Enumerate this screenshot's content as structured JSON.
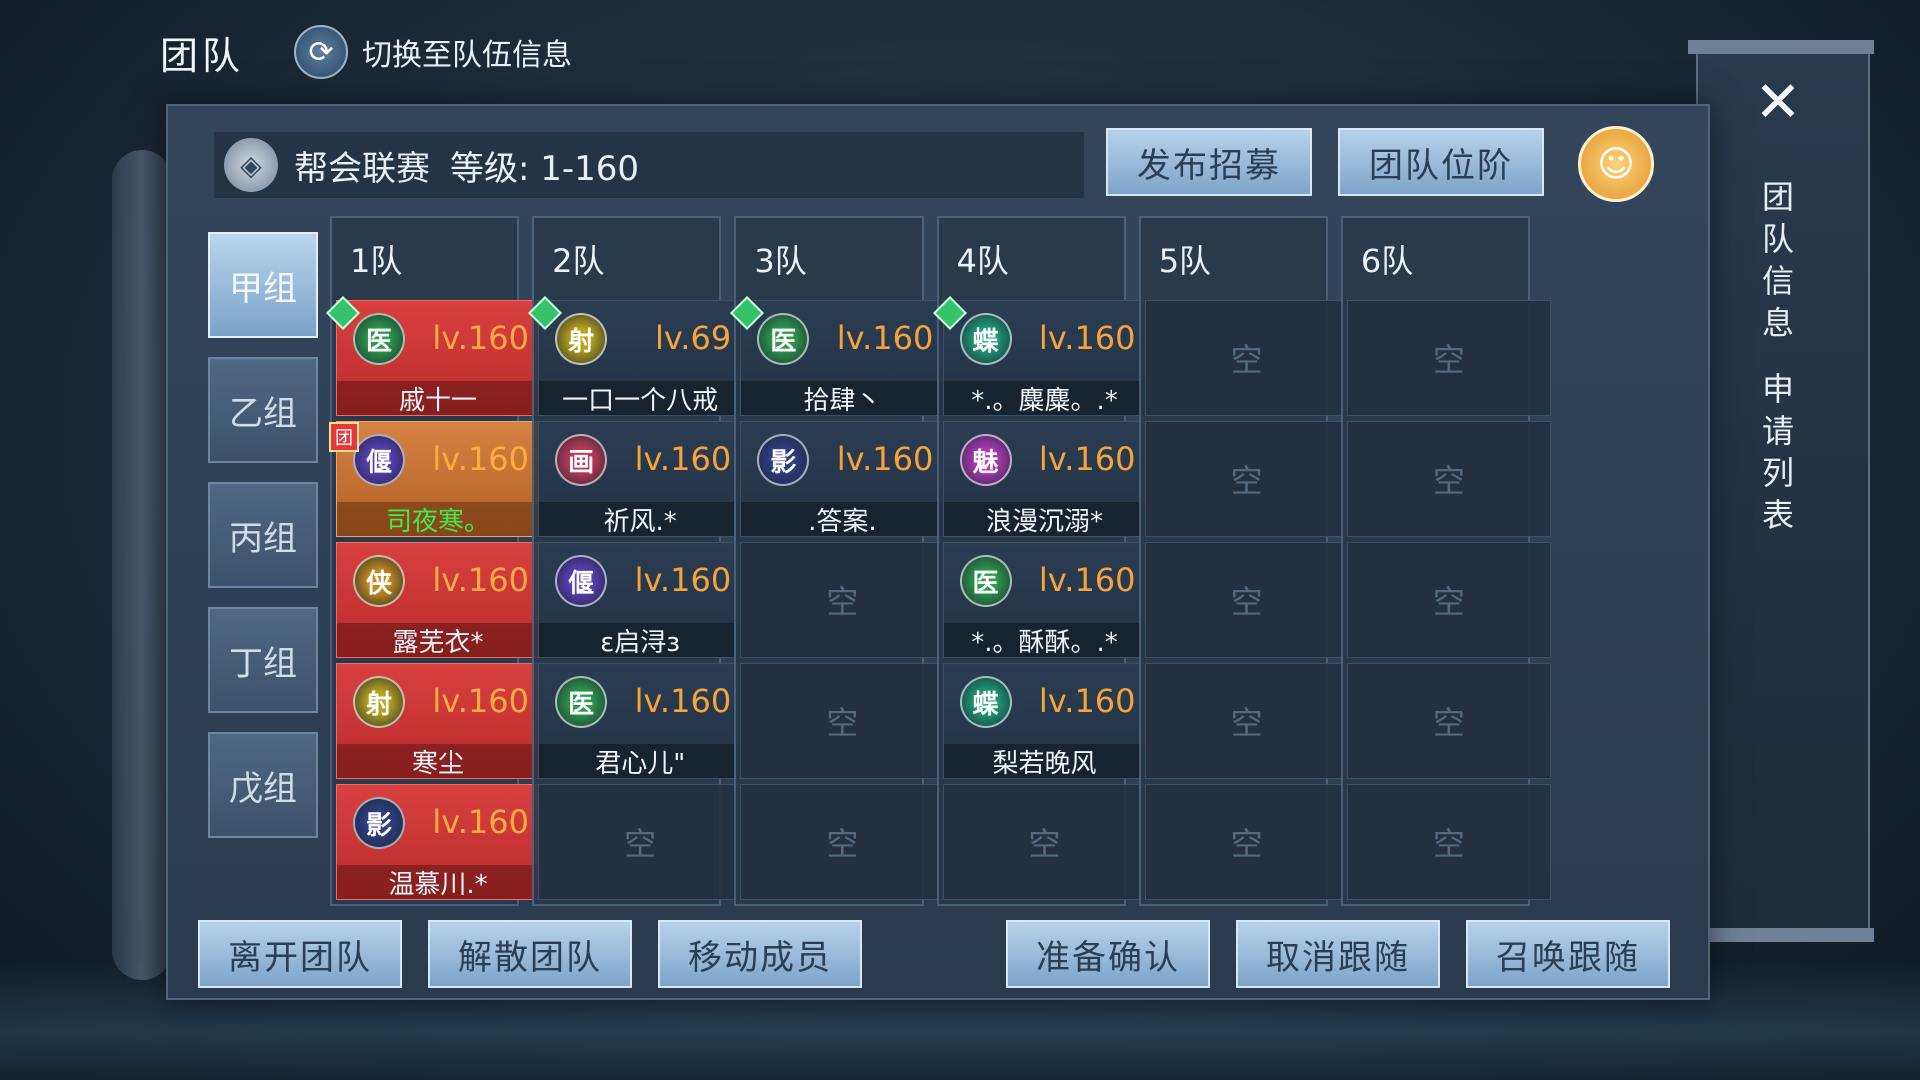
{
  "header": {
    "title": "团队",
    "switch_label": "切换至队伍信息"
  },
  "league": {
    "name": "帮会联赛",
    "level": "等级: 1-160"
  },
  "top_buttons": {
    "recruit": "发布招募",
    "rank": "团队位阶"
  },
  "groups": [
    "甲组",
    "乙组",
    "丙组",
    "丁组",
    "戊组"
  ],
  "active_group": "甲组",
  "empty_label": "空",
  "teams": [
    {
      "label": "1队",
      "slots": [
        {
          "class": "医",
          "level": "lv.160",
          "name": "戚十一",
          "style": "red",
          "badge": "gem"
        },
        {
          "class": "偃",
          "level": "lv.160",
          "name": "司夜寒。",
          "style": "orange",
          "badge": "leader",
          "badge_text": "团"
        },
        {
          "class": "侠",
          "level": "lv.160",
          "name": "露芜衣*",
          "style": "red"
        },
        {
          "class": "射",
          "level": "lv.160",
          "name": "寒尘",
          "style": "red"
        },
        {
          "class": "影",
          "level": "lv.160",
          "name": "温慕川.*",
          "style": "red"
        }
      ]
    },
    {
      "label": "2队",
      "slots": [
        {
          "class": "射",
          "level": "lv.69",
          "name": "一口一个八戒",
          "style": "normal",
          "badge": "gem"
        },
        {
          "class": "画",
          "level": "lv.160",
          "name": "祈风.*",
          "style": "normal"
        },
        {
          "class": "偃",
          "level": "lv.160",
          "name": "ε启浔з",
          "style": "normal"
        },
        {
          "class": "医",
          "level": "lv.160",
          "name": "君心儿\"",
          "style": "normal"
        },
        null
      ]
    },
    {
      "label": "3队",
      "slots": [
        {
          "class": "医",
          "level": "lv.160",
          "name": "拾肆丶",
          "style": "normal",
          "badge": "gem"
        },
        {
          "class": "影",
          "level": "lv.160",
          "name": ".答案.",
          "style": "normal"
        },
        null,
        null,
        null
      ]
    },
    {
      "label": "4队",
      "slots": [
        {
          "class": "蝶",
          "level": "lv.160",
          "name": "*.。麋麋。.*",
          "style": "normal",
          "badge": "gem"
        },
        {
          "class": "魅",
          "level": "lv.160",
          "name": "浪漫沉溺*",
          "style": "normal"
        },
        {
          "class": "医",
          "level": "lv.160",
          "name": "*.。酥酥。.*",
          "style": "normal"
        },
        {
          "class": "蝶",
          "level": "lv.160",
          "name": "梨若晚风",
          "style": "normal"
        },
        null
      ]
    },
    {
      "label": "5队",
      "slots": [
        null,
        null,
        null,
        null,
        null
      ]
    },
    {
      "label": "6队",
      "slots": [
        null,
        null,
        null,
        null,
        null
      ]
    }
  ],
  "class_colors": {
    "医": "#2e9a4c",
    "偃": "#5a3fb8",
    "侠": "#c68a1e",
    "射": "#b8a21e",
    "影": "#2f3f86",
    "画": "#c23a5a",
    "蝶": "#1f9c7a",
    "魅": "#b03ab8"
  },
  "bottom_buttons": [
    "离开团队",
    "解散团队",
    "移动成员",
    "准备确认",
    "取消跟随",
    "召唤跟随"
  ],
  "side_tabs": {
    "team_info": "团队信息",
    "apply_list": "申请列表"
  },
  "icons": {
    "switch": "refresh-icon",
    "league": "league-emblem-icon",
    "avatar": "add-friend-icon",
    "close": "close-icon"
  }
}
